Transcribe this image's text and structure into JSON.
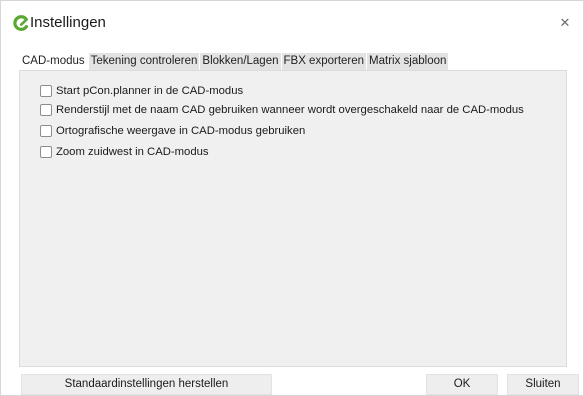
{
  "window": {
    "title": "Instellingen",
    "logo_icon": "pcon-logo-icon",
    "brand_color": "#5aa832",
    "close_icon": "close-icon",
    "close_glyph": "✕"
  },
  "tabs": [
    {
      "label": "CAD-modus",
      "active": true
    },
    {
      "label": "Tekening controleren",
      "active": false
    },
    {
      "label": "Blokken/Lagen",
      "active": false
    },
    {
      "label": "FBX exporteren",
      "active": false
    },
    {
      "label": "Matrix sjabloon",
      "active": false
    }
  ],
  "options": [
    {
      "label": "Start pCon.planner in de CAD-modus",
      "checked": false
    },
    {
      "label": "Renderstijl met de naam CAD gebruiken wanneer wordt overgeschakeld naar de CAD-modus",
      "checked": false
    },
    {
      "label": "Ortografische weergave in CAD-modus gebruiken",
      "checked": false
    },
    {
      "label": "Zoom zuidwest in CAD-modus",
      "checked": false
    }
  ],
  "footer": {
    "reset_label": "Standaardinstellingen herstellen",
    "ok_label": "OK",
    "close_label": "Sluiten"
  }
}
